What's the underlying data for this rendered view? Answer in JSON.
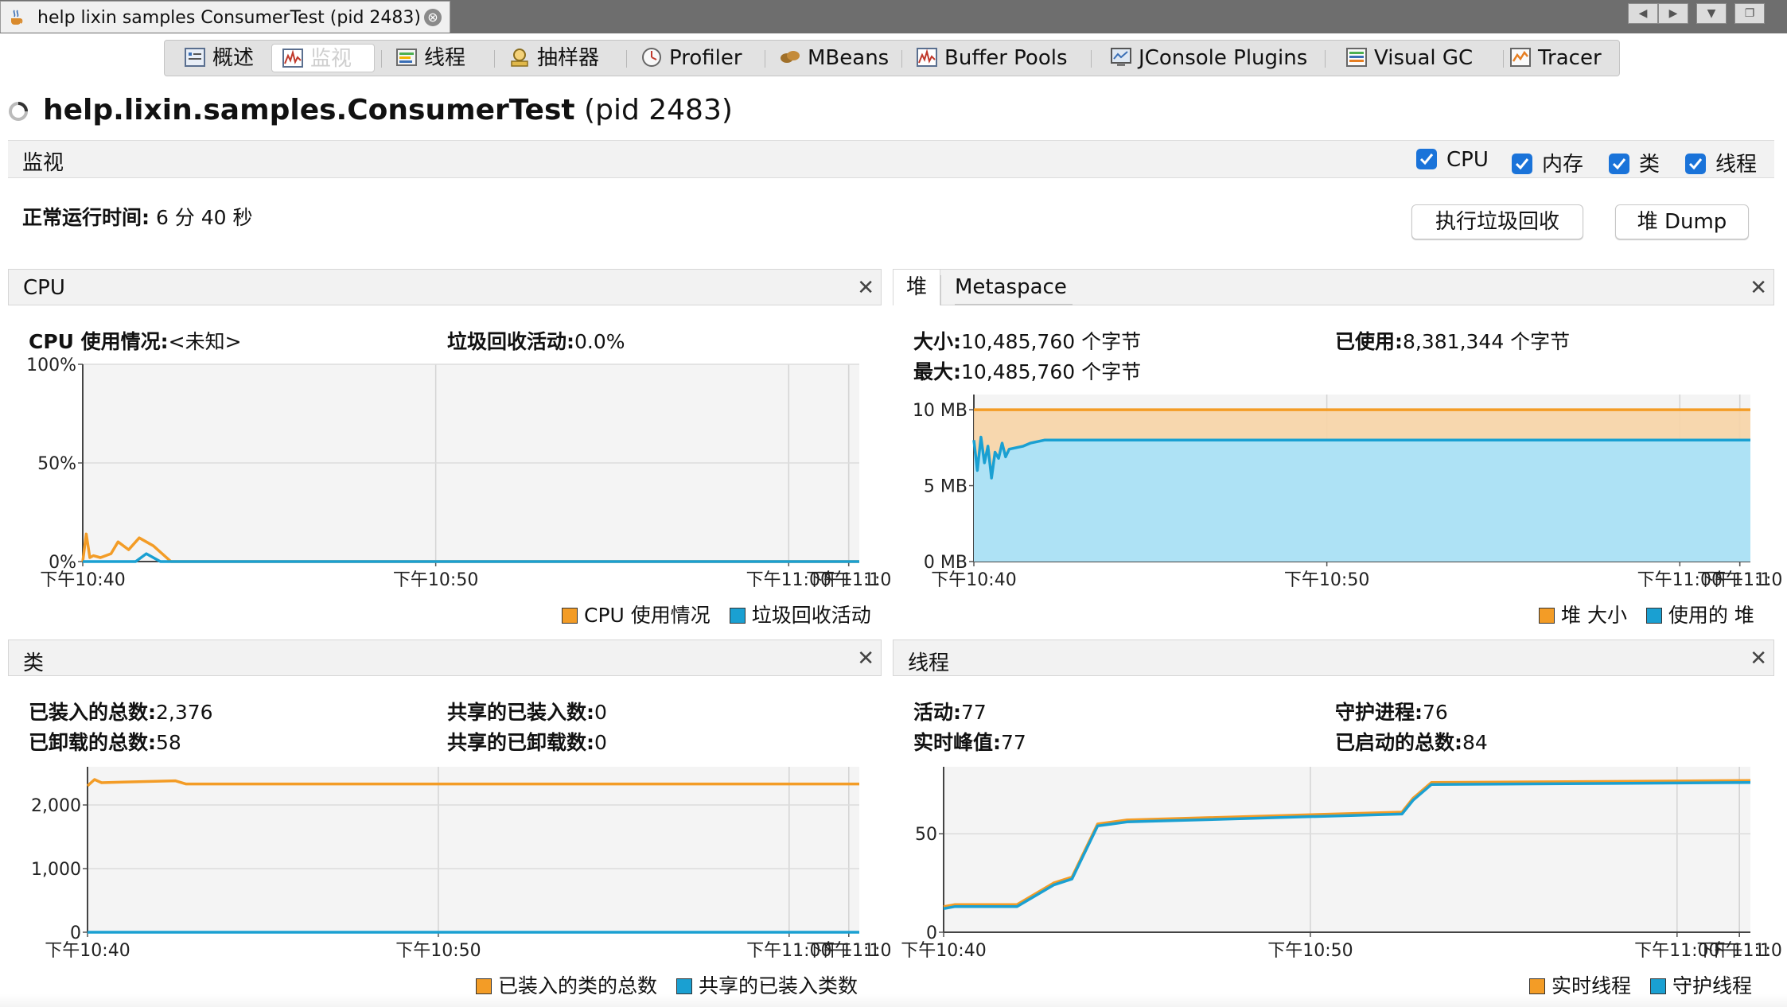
{
  "window": {
    "tab_title": "help lixin samples ConsumerTest (pid 2483)",
    "close_glyph": "⊗"
  },
  "toolbar": {
    "items": [
      {
        "label": "概述",
        "icon": "overview-icon"
      },
      {
        "label": "监视",
        "icon": "monitor-icon"
      },
      {
        "label": "线程",
        "icon": "threads-icon"
      },
      {
        "label": "抽样器",
        "icon": "sampler-icon"
      },
      {
        "label": "Profiler",
        "icon": "profiler-icon"
      },
      {
        "label": "MBeans",
        "icon": "mbeans-icon"
      },
      {
        "label": "Buffer Pools",
        "icon": "buffer-pools-icon"
      },
      {
        "label": "JConsole Plugins",
        "icon": "jconsole-icon"
      },
      {
        "label": "Visual GC",
        "icon": "visual-gc-icon"
      },
      {
        "label": "Tracer",
        "icon": "tracer-icon"
      }
    ],
    "active": "监视"
  },
  "header": {
    "app_name": "help.lixin.samples.ConsumerTest",
    "pid": "(pid 2483)",
    "section": "监视",
    "checkboxes": [
      {
        "label": "CPU",
        "checked": true
      },
      {
        "label": "内存",
        "checked": true
      },
      {
        "label": "类",
        "checked": true
      },
      {
        "label": "线程",
        "checked": true
      }
    ],
    "uptime_label": "正常运行时间:",
    "uptime_value": "6 分 40 秒",
    "gc_button": "执行垃圾回收",
    "heap_dump_button": "堆 Dump"
  },
  "cpu_panel": {
    "title": "CPU",
    "usage_label": "CPU 使用情况:",
    "usage_value": "<未知>",
    "gc_label": "垃圾回收活动:",
    "gc_value": "0.0%",
    "legend": [
      "CPU 使用情况",
      "垃圾回收活动"
    ]
  },
  "heap_panel": {
    "tab_heap": "堆",
    "tab_metaspace": "Metaspace",
    "size_label": "大小:",
    "size_value": "10,485,760 个字节",
    "max_label": "最大:",
    "max_value": "10,485,760 个字节",
    "used_label": "已使用:",
    "used_value": "8,381,344 个字节",
    "legend": [
      "堆 大小",
      "使用的 堆"
    ]
  },
  "classes_panel": {
    "title": "类",
    "loaded_label": "已装入的总数:",
    "loaded_value": "2,376",
    "unloaded_label": "已卸载的总数:",
    "unloaded_value": "58",
    "shared_loaded_label": "共享的已装入数:",
    "shared_loaded_value": "0",
    "shared_unloaded_label": "共享的已卸载数:",
    "shared_unloaded_value": "0",
    "legend": [
      "已装入的类的总数",
      "共享的已装入类数"
    ]
  },
  "threads_panel": {
    "title": "线程",
    "live_label": "活动:",
    "live_value": "77",
    "peak_label": "实时峰值:",
    "peak_value": "77",
    "daemon_label": "守护进程:",
    "daemon_value": "76",
    "started_label": "已启动的总数:",
    "started_value": "84",
    "legend": [
      "实时线程",
      "守护线程"
    ]
  },
  "colors": {
    "orange": "#f39c26",
    "blue": "#1aa0d2",
    "heap_fill": "#f7d4a6",
    "used_fill": "#aee2f5"
  },
  "chart_data": [
    {
      "type": "line",
      "title": "CPU",
      "x_ticks": [
        "下午10:40",
        "下午10:50",
        "下午11:00",
        "下午11:10",
        "下午11:"
      ],
      "y_ticks": [
        "0%",
        "50%",
        "100%"
      ],
      "ylim": [
        0,
        100
      ],
      "grid": true,
      "legend_position": "bottom-right",
      "series": [
        {
          "name": "CPU 使用情况",
          "x": [
            0,
            0.1,
            0.2,
            0.3,
            0.5,
            0.8,
            1.0,
            1.3,
            1.6,
            2.0,
            2.5,
            22
          ],
          "values": [
            0,
            14,
            2,
            3,
            2,
            4,
            10,
            6,
            12,
            8,
            0,
            0
          ]
        },
        {
          "name": "垃圾回收活动",
          "x": [
            0,
            1.5,
            1.8,
            2.2,
            22
          ],
          "values": [
            0,
            0,
            4,
            0,
            0
          ]
        }
      ]
    },
    {
      "type": "area",
      "title": "堆",
      "x_ticks": [
        "下午10:40",
        "下午10:50",
        "下午11:00",
        "下午11:10",
        "下午11:"
      ],
      "y_ticks": [
        "0 MB",
        "5 MB",
        "10 MB"
      ],
      "ylim": [
        0,
        11
      ],
      "grid": true,
      "legend_position": "bottom-right",
      "series": [
        {
          "name": "堆 大小",
          "x": [
            0,
            22
          ],
          "values": [
            10,
            10
          ]
        },
        {
          "name": "使用的 堆",
          "x": [
            0,
            0.1,
            0.2,
            0.3,
            0.4,
            0.5,
            0.6,
            0.7,
            0.8,
            0.9,
            1.0,
            1.2,
            1.4,
            1.6,
            1.8,
            2.0,
            22
          ],
          "values": [
            8.0,
            6.0,
            8.2,
            6.5,
            7.6,
            5.5,
            7.2,
            6.8,
            7.8,
            6.9,
            7.4,
            7.5,
            7.6,
            7.8,
            7.9,
            8.0,
            8.0
          ]
        }
      ]
    },
    {
      "type": "line",
      "title": "类",
      "x_ticks": [
        "下午10:40",
        "下午10:50",
        "下午11:00",
        "下午11:10",
        "下午11:"
      ],
      "y_ticks": [
        "0",
        "1,000",
        "2,000"
      ],
      "ylim": [
        0,
        2600
      ],
      "grid": true,
      "legend_position": "bottom-right",
      "series": [
        {
          "name": "已装入的类的总数",
          "x": [
            0,
            0.2,
            0.4,
            1.0,
            2.5,
            2.8,
            22
          ],
          "values": [
            2300,
            2400,
            2350,
            2360,
            2380,
            2330,
            2330
          ]
        },
        {
          "name": "共享的已装入类数",
          "x": [
            0,
            22
          ],
          "values": [
            0,
            0
          ]
        }
      ]
    },
    {
      "type": "line",
      "title": "线程",
      "x_ticks": [
        "下午10:40",
        "下午10:50",
        "下午11:00",
        "下午11:10",
        "下午11:"
      ],
      "y_ticks": [
        "0",
        "50"
      ],
      "ylim": [
        0,
        84
      ],
      "grid": true,
      "legend_position": "bottom-right",
      "series": [
        {
          "name": "实时线程",
          "x": [
            0,
            0.3,
            2.0,
            3.0,
            3.5,
            4.2,
            5.0,
            12.5,
            12.8,
            13.3,
            22
          ],
          "values": [
            13,
            14,
            14,
            25,
            28,
            55,
            57,
            61,
            68,
            76,
            77
          ]
        },
        {
          "name": "守护线程",
          "x": [
            0,
            0.3,
            2.0,
            3.0,
            3.5,
            4.2,
            5.0,
            12.5,
            12.8,
            13.3,
            22
          ],
          "values": [
            12,
            13,
            13,
            24,
            27,
            54,
            56,
            60,
            67,
            75,
            76
          ]
        }
      ]
    }
  ]
}
